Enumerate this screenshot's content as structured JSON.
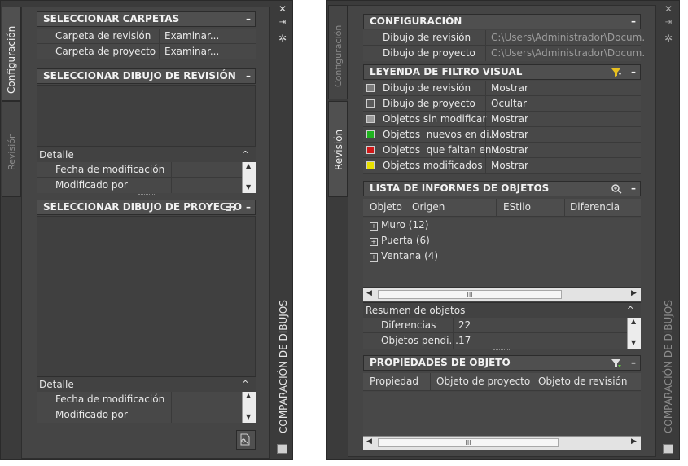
{
  "left": {
    "tabs": [
      "Configuración",
      "Revisión"
    ],
    "title": "COMPARACIÓN DE DIBUJOS",
    "select_folders": {
      "title": "SELECCIONAR CARPETAS",
      "rows": [
        {
          "label": "Carpeta de revisión",
          "value": "Examinar..."
        },
        {
          "label": "Carpeta de proyecto",
          "value": "Examinar..."
        }
      ]
    },
    "select_revision": {
      "title": "SELECCIONAR DIBUJO DE REVISIÓN",
      "detail_title": "Detalle",
      "detail_rows": [
        "Fecha de modificación",
        "Modificado por"
      ]
    },
    "select_project": {
      "title": "SELECCIONAR DIBUJO DE PROYECTO",
      "detail_title": "Detalle",
      "detail_rows": [
        "Fecha de modificación",
        "Modificado por"
      ]
    }
  },
  "right": {
    "tabs": [
      "Configuración",
      "Revisión"
    ],
    "title": "COMPARACIÓN DE DIBUJOS",
    "config": {
      "title": "CONFIGURACIÓN",
      "rows": [
        {
          "label": "Dibujo de revisión",
          "value": "C:\\Users\\Administrador\\Docum..."
        },
        {
          "label": "Dibujo de proyecto",
          "value": "C:\\Users\\Administrador\\Docum..."
        }
      ]
    },
    "legend": {
      "title": "LEYENDA DE FILTRO VISUAL",
      "rows": [
        {
          "label": "Dibujo de revisión",
          "value": "Mostrar",
          "color": "#7a7a7a"
        },
        {
          "label": "Dibujo de proyecto",
          "value": "Ocultar",
          "color": "#5a5a5a"
        },
        {
          "label": "Objetos sin modificar",
          "value": "Mostrar",
          "color": "#9a9a9a"
        },
        {
          "label": "Objetos  nuevos en di...",
          "value": "Mostrar",
          "color": "#1fb31f"
        },
        {
          "label": "Objetos  que faltan en...",
          "value": "Mostrar",
          "color": "#d01818"
        },
        {
          "label": "Objetos modificados",
          "value": "Mostrar",
          "color": "#e8e000"
        }
      ]
    },
    "report": {
      "title": "LISTA DE INFORMES DE OBJETOS",
      "columns": [
        "Objeto",
        "Origen",
        "EStilo",
        "Diferencia"
      ],
      "items": [
        "Muro (12)",
        "Puerta (6)",
        "Ventana (4)"
      ],
      "hscroll_label": "III",
      "summary_title": "Resumen de objetos",
      "summary_rows": [
        {
          "label": "Diferencias",
          "value": "22"
        },
        {
          "label": "Objetos pendi...",
          "value": "17"
        }
      ]
    },
    "props": {
      "title": "PROPIEDADES DE OBJETO",
      "columns": [
        "Propiedad",
        "Objeto de proyecto",
        "Objeto de revisión"
      ],
      "hscroll_label": "III"
    }
  }
}
